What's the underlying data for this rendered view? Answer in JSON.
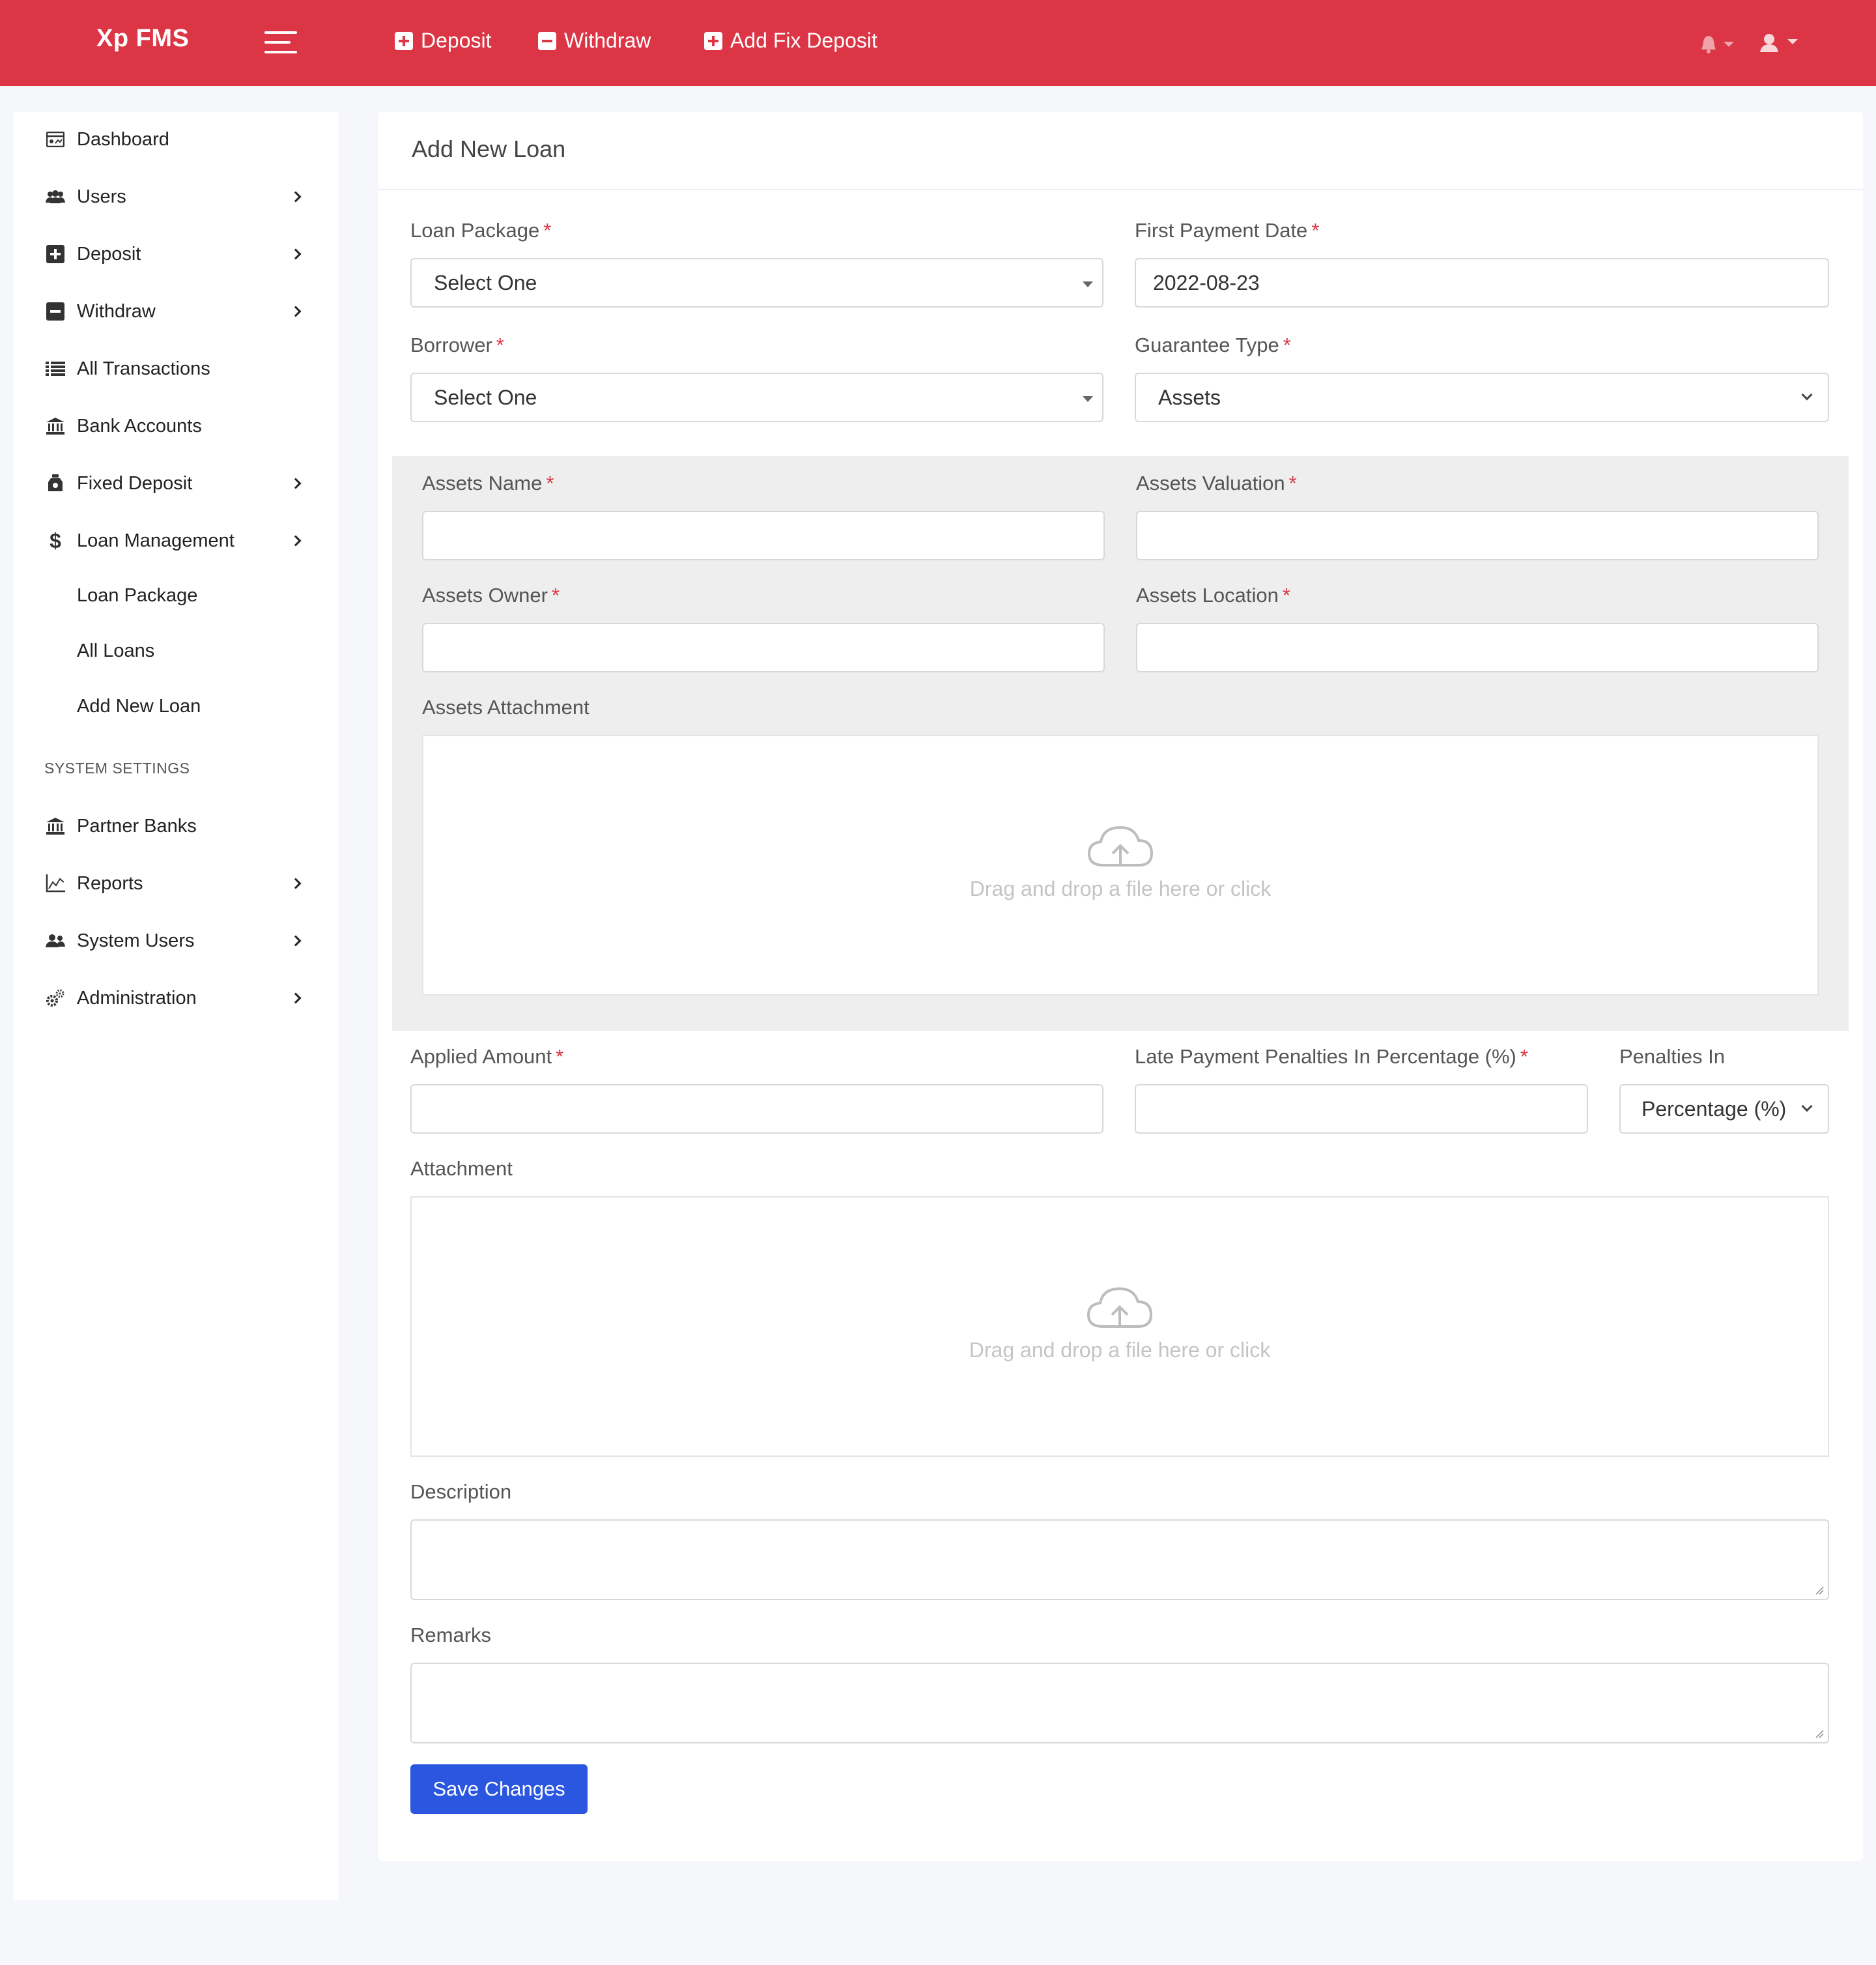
{
  "app": {
    "brand": "Xp FMS"
  },
  "topnav": {
    "links": [
      {
        "label": "Deposit",
        "icon": "plus-square-icon"
      },
      {
        "label": "Withdraw",
        "icon": "minus-square-icon"
      },
      {
        "label": "Add Fix Deposit",
        "icon": "plus-square-icon"
      }
    ]
  },
  "sidebar": {
    "items": [
      {
        "label": "Dashboard",
        "icon": "dashboard-icon",
        "has_children": false
      },
      {
        "label": "Users",
        "icon": "users-icon",
        "has_children": true
      },
      {
        "label": "Deposit",
        "icon": "plus-square-icon",
        "has_children": true
      },
      {
        "label": "Withdraw",
        "icon": "minus-square-icon",
        "has_children": true
      },
      {
        "label": "All Transactions",
        "icon": "list-icon",
        "has_children": false
      },
      {
        "label": "Bank Accounts",
        "icon": "bank-icon",
        "has_children": false
      },
      {
        "label": "Fixed Deposit",
        "icon": "money-bag-icon",
        "has_children": true
      },
      {
        "label": "Loan Management",
        "icon": "dollar-icon",
        "has_children": true
      }
    ],
    "loan_submenu": [
      "Loan Package",
      "All Loans",
      "Add New Loan"
    ],
    "section_title": "SYSTEM SETTINGS",
    "settings_items": [
      {
        "label": "Partner Banks",
        "icon": "bank-icon",
        "has_children": false
      },
      {
        "label": "Reports",
        "icon": "chart-line-icon",
        "has_children": true
      },
      {
        "label": "System Users",
        "icon": "users-icon",
        "has_children": true
      },
      {
        "label": "Administration",
        "icon": "gears-icon",
        "has_children": true
      }
    ]
  },
  "form": {
    "title": "Add New Loan",
    "loan_package": {
      "label": "Loan Package",
      "value": "Select One"
    },
    "first_payment_date": {
      "label": "First Payment Date",
      "value": "2022-08-23"
    },
    "borrower": {
      "label": "Borrower",
      "value": "Select One"
    },
    "guarantee_type": {
      "label": "Guarantee Type",
      "value": "Assets"
    },
    "assets": {
      "name_label": "Assets Name",
      "valuation_label": "Assets Valuation",
      "owner_label": "Assets Owner",
      "location_label": "Assets Location",
      "attachment_label": "Assets Attachment",
      "dropzone_text": "Drag and drop a file here or click"
    },
    "applied_amount": {
      "label": "Applied Amount",
      "value": ""
    },
    "late_penalties": {
      "label": "Late Payment Penalties In Percentage (%)",
      "value": ""
    },
    "penalties_in": {
      "label": "Penalties In",
      "value": "Percentage (%)"
    },
    "attachment": {
      "label": "Attachment",
      "dropzone_text": "Drag and drop a file here or click"
    },
    "description": {
      "label": "Description",
      "value": ""
    },
    "remarks": {
      "label": "Remarks",
      "value": ""
    },
    "required_mark": "*",
    "save_label": "Save Changes"
  },
  "colors": {
    "topbar": "#dc3545",
    "primary_button": "#2a56e0",
    "required": "#dc3545"
  }
}
